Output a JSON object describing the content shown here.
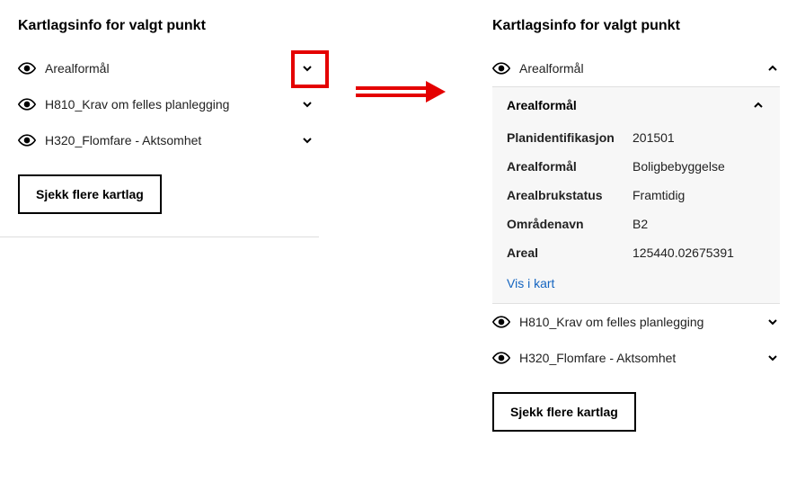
{
  "left": {
    "title": "Kartlagsinfo for valgt punkt",
    "layers": [
      {
        "label": "Arealformål"
      },
      {
        "label": "H810_Krav om felles planlegging"
      },
      {
        "label": "H320_Flomfare - Aktsomhet"
      }
    ],
    "check_button": "Sjekk flere kartlag"
  },
  "right": {
    "title": "Kartlagsinfo for valgt punkt",
    "expanded_layer": {
      "label": "Arealformål",
      "sub_header": "Arealformål",
      "details": [
        {
          "key": "Planidentifikasjon",
          "val": "201501"
        },
        {
          "key": "Arealformål",
          "val": "Boligbebyggelse"
        },
        {
          "key": "Arealbrukstatus",
          "val": "Framtidig"
        },
        {
          "key": "Områdenavn",
          "val": "B2"
        },
        {
          "key": "Areal",
          "val": "125440.02675391"
        }
      ],
      "vis_link": "Vis i kart"
    },
    "collapsed_layers": [
      {
        "label": "H810_Krav om felles planlegging"
      },
      {
        "label": "H320_Flomfare - Aktsomhet"
      }
    ],
    "check_button": "Sjekk flere kartlag"
  }
}
